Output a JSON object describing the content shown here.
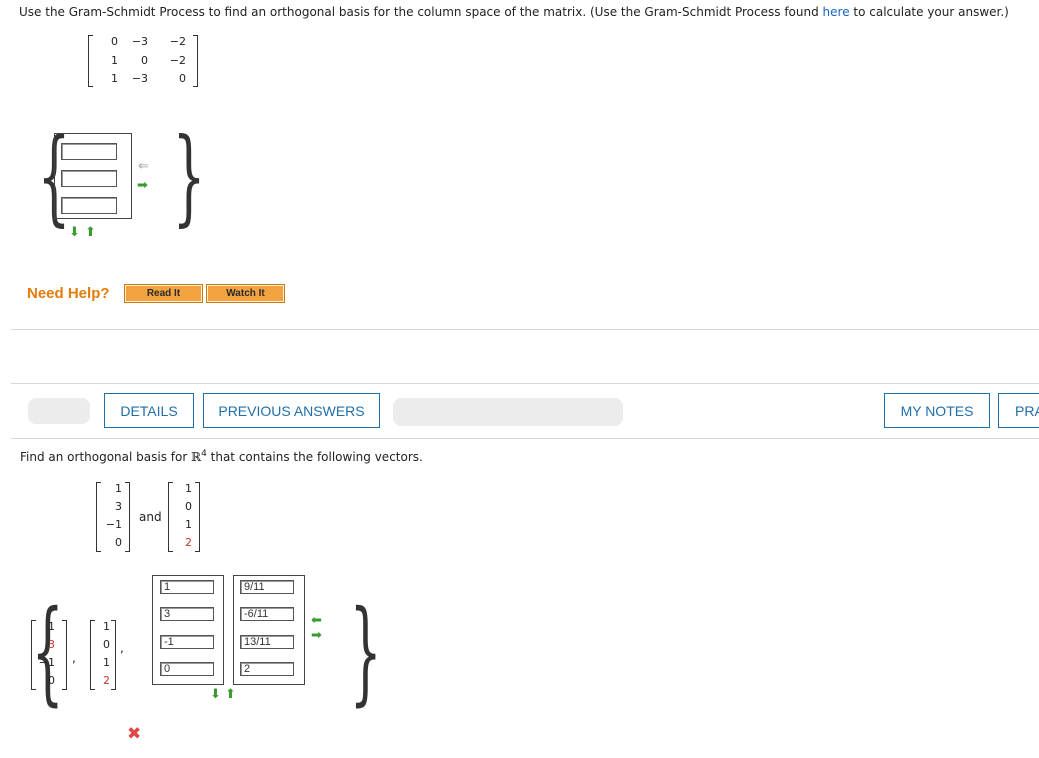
{
  "question1": {
    "instruction_prefix": "Use the Gram-Schmidt Process to find an orthogonal basis for the column space of the matrix. (Use the Gram-Schmidt Process found ",
    "link_text": "here",
    "instruction_suffix": " to calculate your answer.)",
    "matrix": [
      [
        "0",
        "−3",
        "−2"
      ],
      [
        "1",
        "0",
        "−2"
      ],
      [
        "1",
        "−3",
        "0"
      ]
    ],
    "answer_inputs": [
      "",
      "",
      ""
    ]
  },
  "help": {
    "label": "Need Help?",
    "read_it": "Read It",
    "watch_it": "Watch It"
  },
  "toolbar": {
    "details": "DETAILS",
    "previous_answers": "PREVIOUS ANSWERS",
    "my_notes": "MY NOTES",
    "practice_partial": "PRA"
  },
  "question2": {
    "prompt_prefix": "Find an orthogonal basis for ",
    "space_symbol": "ℝ",
    "space_exp": "4",
    "prompt_suffix": " that contains the following vectors.",
    "vector1": [
      "1",
      "3",
      "−1",
      "0"
    ],
    "vector2": [
      "1",
      "0",
      "1",
      "2"
    ],
    "and_word": "and",
    "answer_v1": [
      "1",
      "3",
      "−1",
      "0"
    ],
    "answer_v2": [
      "1",
      "0",
      "1",
      "2"
    ],
    "answer_input_col1": [
      "1",
      "3",
      "-1",
      "0"
    ],
    "answer_input_col2": [
      "9/11",
      "-6/11",
      "13/11",
      "2"
    ],
    "comma": ",",
    "incorrect_mark": "✖"
  },
  "colors": {
    "link": "#1565c0",
    "help_orange": "#e57c0a",
    "button_blue": "#1f6fa8",
    "arrow_green": "#3a9a2f",
    "incorrect_red": "#e04848"
  }
}
